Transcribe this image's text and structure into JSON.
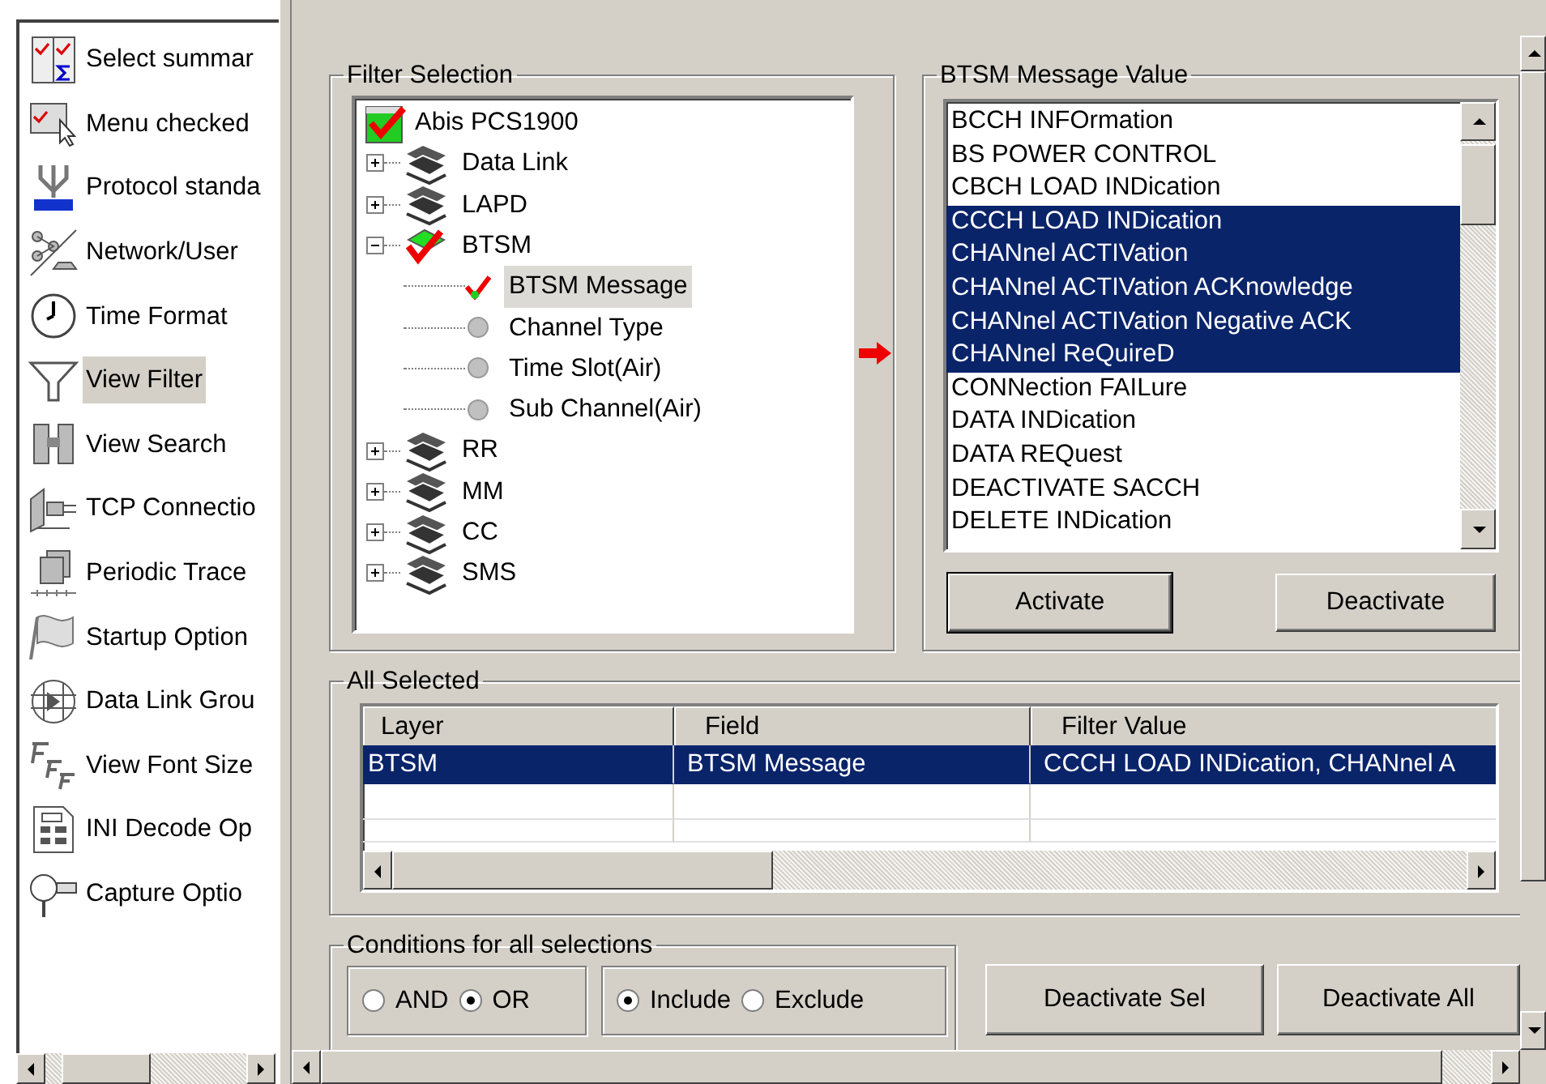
{
  "sidebar": {
    "items": [
      {
        "label": "Select summar",
        "selected": false
      },
      {
        "label": "Menu checked",
        "selected": false
      },
      {
        "label": "Protocol standa",
        "selected": false
      },
      {
        "label": "Network/User",
        "selected": false
      },
      {
        "label": "Time Format",
        "selected": false
      },
      {
        "label": "View Filter",
        "selected": true
      },
      {
        "label": "View Search",
        "selected": false
      },
      {
        "label": "TCP Connectio",
        "selected": false
      },
      {
        "label": "Periodic Trace",
        "selected": false
      },
      {
        "label": "Startup Option",
        "selected": false
      },
      {
        "label": "Data Link Grou",
        "selected": false
      },
      {
        "label": "View Font Size",
        "selected": false
      },
      {
        "label": "INI Decode Op",
        "selected": false
      },
      {
        "label": "Capture Optio",
        "selected": false
      }
    ]
  },
  "filter_selection": {
    "title": "Filter Selection",
    "tree": [
      {
        "label": "Abis PCS1900",
        "kind": "root",
        "checked": true,
        "selected": false,
        "children": [
          {
            "label": "Data Link",
            "kind": "layer",
            "checked": false,
            "expanded": false,
            "selected": false
          },
          {
            "label": "LAPD",
            "kind": "layer",
            "checked": false,
            "expanded": false,
            "selected": false
          },
          {
            "label": "BTSM",
            "kind": "layer",
            "checked": true,
            "expanded": true,
            "selected": false,
            "children": [
              {
                "label": "BTSM Message",
                "kind": "field",
                "checked": true,
                "selected": true
              },
              {
                "label": "Channel Type",
                "kind": "field",
                "checked": false,
                "selected": false
              },
              {
                "label": "Time Slot(Air)",
                "kind": "field",
                "checked": false,
                "selected": false
              },
              {
                "label": "Sub Channel(Air)",
                "kind": "field",
                "checked": false,
                "selected": false
              }
            ]
          },
          {
            "label": "RR",
            "kind": "layer",
            "checked": false,
            "expanded": false,
            "selected": false
          },
          {
            "label": "MM",
            "kind": "layer",
            "checked": false,
            "expanded": false,
            "selected": false
          },
          {
            "label": "CC",
            "kind": "layer",
            "checked": false,
            "expanded": false,
            "selected": false
          },
          {
            "label": "SMS",
            "kind": "layer",
            "checked": false,
            "expanded": false,
            "selected": false
          }
        ]
      }
    ]
  },
  "message_value": {
    "title": "BTSM Message Value",
    "items": [
      {
        "label": "BCCH INFOrmation",
        "selected": false
      },
      {
        "label": "BS POWER CONTROL",
        "selected": false
      },
      {
        "label": "CBCH LOAD INDication",
        "selected": false
      },
      {
        "label": "CCCH LOAD INDication",
        "selected": true
      },
      {
        "label": "CHANnel ACTIVation",
        "selected": true
      },
      {
        "label": "CHANnel ACTIVation ACKnowledge",
        "selected": true
      },
      {
        "label": "CHANnel ACTIVation Negative ACK",
        "selected": true
      },
      {
        "label": "CHANnel ReQuireD",
        "selected": true
      },
      {
        "label": "CONNection FAILure",
        "selected": false
      },
      {
        "label": "DATA INDication",
        "selected": false
      },
      {
        "label": "DATA REQuest",
        "selected": false
      },
      {
        "label": "DEACTIVATE SACCH",
        "selected": false
      },
      {
        "label": "DELETE INDication",
        "selected": false
      }
    ],
    "buttons": [
      {
        "label": "Activate",
        "default": true
      },
      {
        "label": "Deactivate",
        "default": false
      }
    ]
  },
  "all_selected": {
    "title": "All Selected",
    "columns": [
      "Layer",
      "Field",
      "Filter Value"
    ],
    "rows": [
      {
        "cells": [
          "BTSM",
          "BTSM Message",
          "CCCH LOAD INDication, CHANnel A"
        ],
        "selected": true
      }
    ]
  },
  "conditions": {
    "title": "Conditions for all selections",
    "logic": [
      {
        "label": "AND",
        "selected": false
      },
      {
        "label": "OR",
        "selected": true
      }
    ],
    "scope": [
      {
        "label": "Include",
        "selected": true
      },
      {
        "label": "Exclude",
        "selected": false
      }
    ]
  },
  "buttons": [
    "Deactivate Sel",
    "Deactivate All"
  ]
}
